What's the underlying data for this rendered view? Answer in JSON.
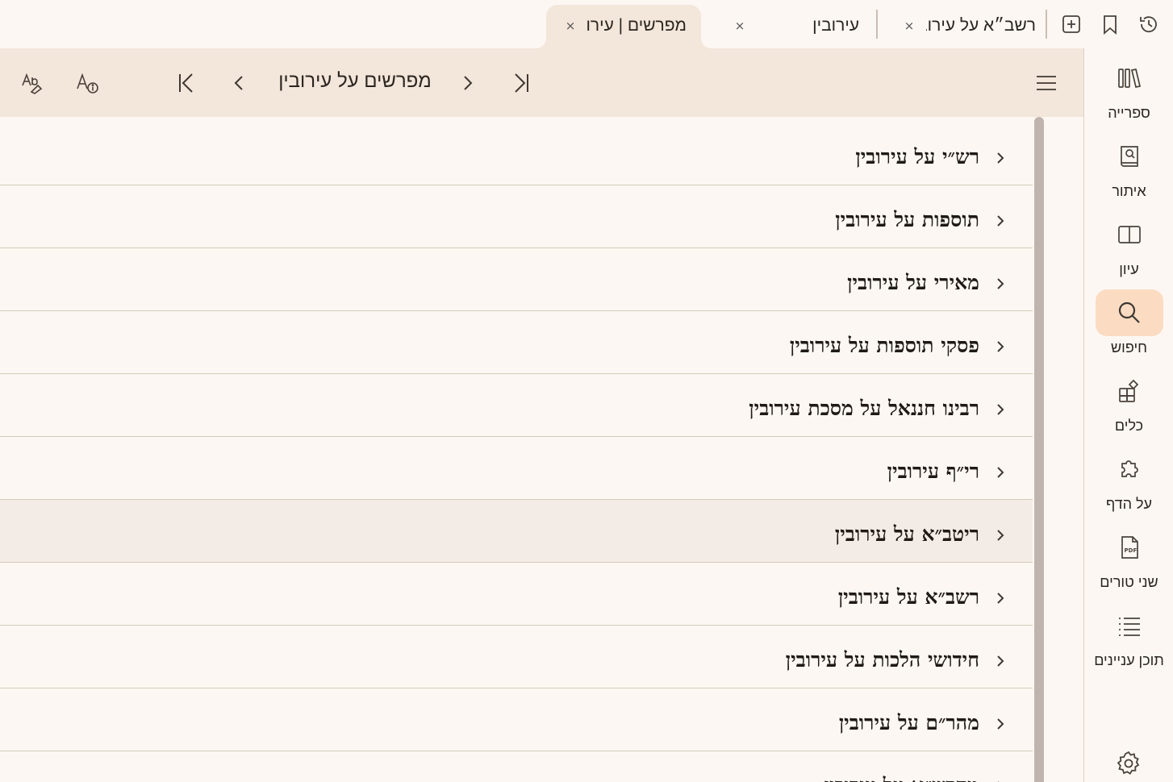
{
  "tabs": [
    {
      "label": "מפרשים | עירובין",
      "active": true
    },
    {
      "label": "עירובין",
      "active": false
    },
    {
      "label": "רשב״א על עירובין",
      "active": false
    }
  ],
  "tab_close_symbol": "×",
  "tabbar_icons": [
    "add-tab-icon",
    "bookmark-icon",
    "history-icon"
  ],
  "toolbar": {
    "title": "מפרשים על עירובין",
    "buttons": [
      "menu-icon",
      "last-page-icon",
      "next-icon",
      "previous-icon",
      "first-page-icon",
      "text-info-icon",
      "font-style-icon"
    ]
  },
  "commentaries": [
    {
      "label": "רש״י על עירובין",
      "selected": false
    },
    {
      "label": "תוספות על עירובין",
      "selected": false
    },
    {
      "label": "מאירי על עירובין",
      "selected": false
    },
    {
      "label": "פסקי תוספות על עירובין",
      "selected": false
    },
    {
      "label": "רבינו חננאל על מסכת עירובין",
      "selected": false
    },
    {
      "label": "רי״ף עירובין",
      "selected": false
    },
    {
      "label": "ריטב״א על עירובין",
      "selected": true
    },
    {
      "label": "רשב״א על עירובין",
      "selected": false
    },
    {
      "label": "חידושי הלכות על עירובין",
      "selected": false
    },
    {
      "label": "מהר״ם על עירובין",
      "selected": false
    },
    {
      "label": "מהרש״א על עירובין",
      "selected": false
    }
  ],
  "nav": [
    {
      "label": "ספרייה",
      "icon": "library-icon",
      "active": false
    },
    {
      "label": "איתור",
      "icon": "find-book-icon",
      "active": false
    },
    {
      "label": "עיון",
      "icon": "open-book-icon",
      "active": false
    },
    {
      "label": "חיפוש",
      "icon": "search-icon",
      "active": true
    },
    {
      "label": "כלים",
      "icon": "tools-icon",
      "active": false
    },
    {
      "label": "על הדף",
      "icon": "puzzle-icon",
      "active": false
    },
    {
      "label": "שני טורים",
      "icon": "pdf-icon",
      "active": false
    },
    {
      "label": "תוכן עניינים",
      "icon": "list-icon",
      "active": false
    }
  ],
  "settings_icon": "gear-icon",
  "colors": {
    "background": "#fdf7f3",
    "toolbar": "#f3e6da",
    "active_nav": "#fbdcc2",
    "selected_row": "#f3ece6",
    "divider": "#d2cdb8",
    "scrollbar": "#c0b5ae"
  }
}
